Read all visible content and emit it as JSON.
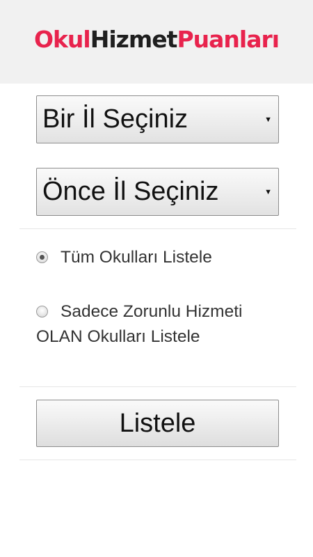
{
  "header": {
    "logo_part1": "Okul",
    "logo_part2": "Hizmet",
    "logo_part3": "Puanları"
  },
  "form": {
    "il_select": {
      "value": "Bir İl Seçiniz"
    },
    "ilce_select": {
      "value": "Önce İl Seçiniz"
    },
    "options": [
      {
        "label": "Tüm Okulları Listele",
        "selected": true
      },
      {
        "label_line1": "Sadece Zorunlu Hizmeti",
        "label_line2": "OLAN Okulları Listele",
        "selected": false
      }
    ],
    "submit_label": "Listele"
  }
}
